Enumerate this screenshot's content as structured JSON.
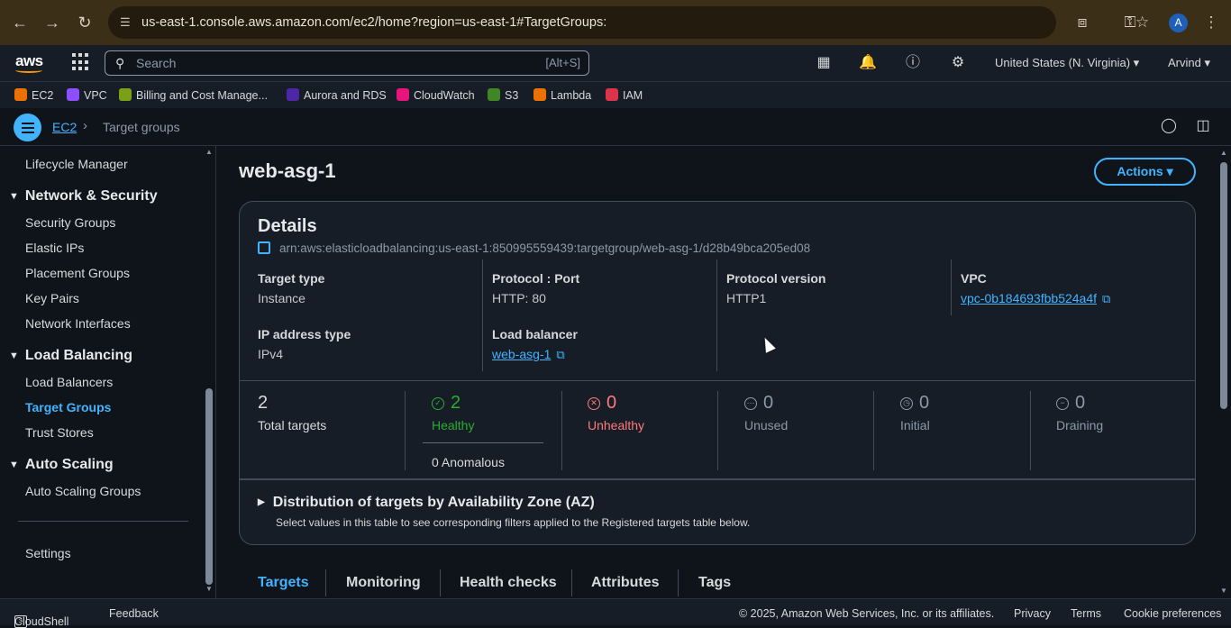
{
  "browser": {
    "url": "us-east-1.console.aws.amazon.com/ec2/home?region=us-east-1#TargetGroups:",
    "avatar_letter": "A"
  },
  "aws_nav": {
    "logo": "aws",
    "search_placeholder": "Search",
    "search_shortcut": "[Alt+S]",
    "region": "United States (N. Virginia) ▾",
    "user": "Arvind ▾"
  },
  "favorites": [
    {
      "label": "EC2",
      "color": "#ed7100"
    },
    {
      "label": "VPC",
      "color": "#8c4fff"
    },
    {
      "label": "Billing and Cost Manage...",
      "color": "#7aa116"
    },
    {
      "label": "Aurora and RDS",
      "color": "#4d27a8"
    },
    {
      "label": "CloudWatch",
      "color": "#e7157b"
    },
    {
      "label": "S3",
      "color": "#3f8624"
    },
    {
      "label": "Lambda",
      "color": "#ed7100"
    },
    {
      "label": "IAM",
      "color": "#dd344c"
    }
  ],
  "breadcrumb": {
    "root": "EC2",
    "current": "Target groups"
  },
  "sidebar": {
    "lifecycle": "Lifecycle Manager",
    "net_sec": "Network & Security",
    "net_items": [
      "Security Groups",
      "Elastic IPs",
      "Placement Groups",
      "Key Pairs",
      "Network Interfaces"
    ],
    "lb": "Load Balancing",
    "lb_items": [
      "Load Balancers",
      "Target Groups",
      "Trust Stores"
    ],
    "as": "Auto Scaling",
    "as_items": [
      "Auto Scaling Groups"
    ],
    "settings": "Settings"
  },
  "main": {
    "title": "web-asg-1",
    "actions": "Actions ▾",
    "details_title": "Details",
    "arn": "arn:aws:elasticloadbalancing:us-east-1:850995559439:targetgroup/web-asg-1/d28b49bca205ed08",
    "target_type_label": "Target type",
    "target_type": "Instance",
    "protocol_label": "Protocol : Port",
    "protocol": "HTTP: 80",
    "protocol_version_label": "Protocol version",
    "protocol_version": "HTTP1",
    "vpc_label": "VPC",
    "vpc": "vpc-0b184693fbb524a4f",
    "ip_type_label": "IP address type",
    "ip_type": "IPv4",
    "lb_label": "Load balancer",
    "lb": "web-asg-1",
    "stats": {
      "total": "2",
      "total_label": "Total targets",
      "healthy": "2",
      "healthy_label": "Healthy",
      "anomalous": "0 Anomalous",
      "unhealthy": "0",
      "unhealthy_label": "Unhealthy",
      "unused": "0",
      "unused_label": "Unused",
      "initial": "0",
      "initial_label": "Initial",
      "draining": "0",
      "draining_label": "Draining"
    },
    "distribution_title": "Distribution of targets by Availability Zone (AZ)",
    "distribution_desc": "Select values in this table to see corresponding filters applied to the Registered targets table below.",
    "tabs": [
      "Targets",
      "Monitoring",
      "Health checks",
      "Attributes",
      "Tags"
    ]
  },
  "footer": {
    "cloudshell": "CloudShell",
    "feedback": "Feedback",
    "copyright": "© 2025, Amazon Web Services, Inc. or its affiliates.",
    "privacy": "Privacy",
    "terms": "Terms",
    "cookies": "Cookie preferences"
  },
  "colors": {
    "accent": "#42b4ff",
    "healthy": "#29ad32",
    "unhealthy": "#ff7a7a"
  }
}
